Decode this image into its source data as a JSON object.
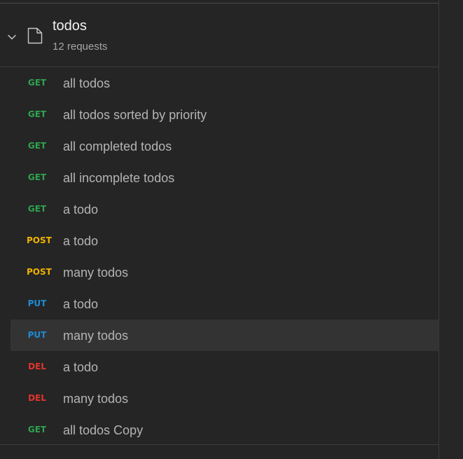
{
  "collection": {
    "name": "todos",
    "subtitle": "12 requests",
    "expanded": true,
    "icons": {
      "toggle": "chevron-down-icon",
      "type": "folder-icon"
    }
  },
  "method_colors": {
    "GET": "#2ea44f",
    "POST": "#f0b400",
    "PUT": "#1e8ad6",
    "DEL": "#e0342a"
  },
  "requests": [
    {
      "method": "GET",
      "name": "all todos"
    },
    {
      "method": "GET",
      "name": "all todos sorted by priority"
    },
    {
      "method": "GET",
      "name": "all completed todos"
    },
    {
      "method": "GET",
      "name": "all incomplete todos"
    },
    {
      "method": "GET",
      "name": "a todo"
    },
    {
      "method": "POST",
      "name": "a todo"
    },
    {
      "method": "POST",
      "name": "many todos"
    },
    {
      "method": "PUT",
      "name": "a todo"
    },
    {
      "method": "PUT",
      "name": "many todos",
      "selected": true
    },
    {
      "method": "DEL",
      "name": "a todo"
    },
    {
      "method": "DEL",
      "name": "many todos"
    },
    {
      "method": "GET",
      "name": "all todos Copy"
    }
  ]
}
